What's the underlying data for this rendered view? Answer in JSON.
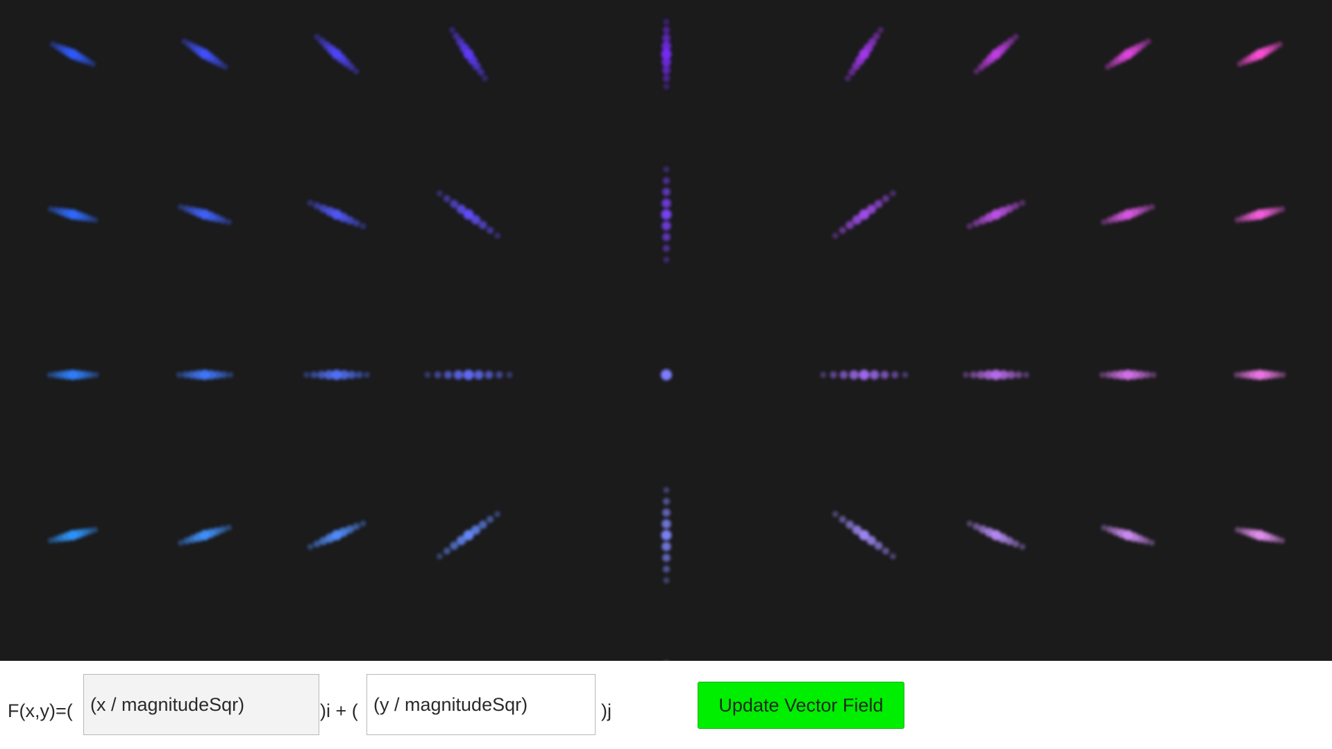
{
  "colors": {
    "background": "#1b1b1c",
    "button": "#00ee00",
    "field_left": "#2f5bff",
    "field_top": "#7a2cff",
    "field_right": "#ff4fd8",
    "field_bottom_left": "#2fb2ff",
    "field_bottom_right": "#d9b0ff",
    "center_dot": "#7d7dff"
  },
  "vector_field": {
    "x_min": -4.5,
    "x_max": 4.5,
    "y_min": -2.5,
    "y_max": 2.5,
    "grid_x": [
      -4.5,
      -3.5,
      -2.5,
      -1.5,
      0,
      1.5,
      2.5,
      3.5,
      4.5
    ],
    "grid_y": [
      2.2,
      1.1,
      0,
      -1.1,
      -2.2
    ]
  },
  "controls": {
    "prefix": "F(x,y)=(",
    "x_expression": "(x / magnitudeSqr)",
    "i_separator": ")i + (",
    "y_expression": "(y / magnitudeSqr)",
    "j_suffix": ")j",
    "update_button_label": "Update Vector Field"
  }
}
